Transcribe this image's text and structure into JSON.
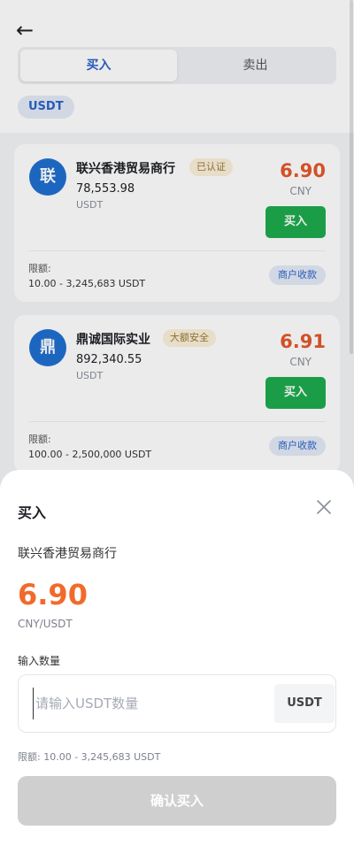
{
  "header": {
    "back_icon": "←",
    "tabs": [
      {
        "label": "买入",
        "active": true
      },
      {
        "label": "卖出",
        "active": false
      }
    ],
    "asset_chip": "USDT"
  },
  "merchants": [
    {
      "avatar_char": "联",
      "name": "联兴香港贸易商行",
      "badge": "已认证",
      "amount": "78,553.98",
      "unit": "USDT",
      "price": "6.90",
      "currency": "CNY",
      "buy_label": "买入",
      "limit_label": "限额:",
      "limit_value": "10.00 - 3,245,683 USDT",
      "payment_tag": "商户收款"
    },
    {
      "avatar_char": "鼎",
      "name": "鼎诚国际实业",
      "badge": "大额安全",
      "amount": "892,340.55",
      "unit": "USDT",
      "price": "6.91",
      "currency": "CNY",
      "buy_label": "买入",
      "limit_label": "限额:",
      "limit_value": "100.00 - 2,500,000 USDT",
      "payment_tag": "商户收款"
    }
  ],
  "sheet": {
    "title": "买入",
    "merchant": "联兴香港贸易商行",
    "price": "6.90",
    "pair": "CNY/USDT",
    "quantity_label": "输入数量",
    "input_value": "",
    "input_placeholder": "请输入USDT数量",
    "input_unit": "USDT",
    "limit": "限额: 10.00 - 3,245,683 USDT",
    "confirm_label": "确认买入"
  },
  "colors": {
    "accent_blue": "#2c63c9",
    "buy_green": "#1eab4f",
    "price_orange": "#e4582b",
    "disabled_gray": "#cfcfcf"
  }
}
